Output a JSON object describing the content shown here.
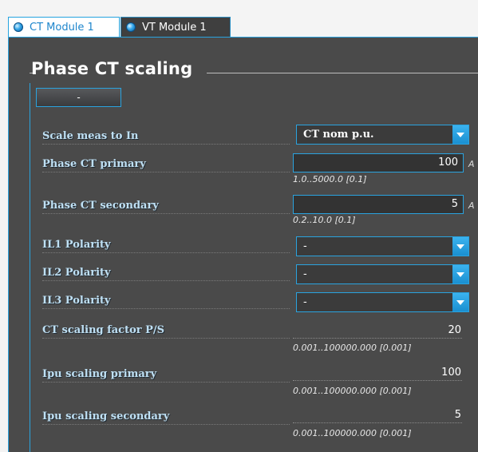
{
  "tabs": [
    {
      "label": "CT Module 1",
      "active": true
    },
    {
      "label": "VT Module 1",
      "active": false
    }
  ],
  "section": {
    "title": "Phase CT scaling",
    "collapse_label": "-"
  },
  "fields": {
    "scale_meas": {
      "label": "Scale meas to In",
      "value": "CT nom p.u."
    },
    "ct_primary": {
      "label": "Phase CT primary",
      "value": "100",
      "unit": "A",
      "range": "1.0..5000.0 [0.1]"
    },
    "ct_secondary": {
      "label": "Phase CT secondary",
      "value": "5",
      "unit": "A",
      "range": "0.2..10.0 [0.1]"
    },
    "il1_polarity": {
      "label": "IL1 Polarity",
      "value": "-"
    },
    "il2_polarity": {
      "label": "IL2 Polarity",
      "value": "-"
    },
    "il3_polarity": {
      "label": "IL3 Polarity",
      "value": "-"
    },
    "ct_scaling_factor": {
      "label": "CT scaling factor P/S",
      "value": "20",
      "range": "0.001..100000.000 [0.001]"
    },
    "ipu_primary": {
      "label": "Ipu scaling primary",
      "value": "100",
      "range": "0.001..100000.000 [0.001]"
    },
    "ipu_secondary": {
      "label": "Ipu scaling secondary",
      "value": "5",
      "range": "0.001..100000.000 [0.001]"
    }
  },
  "colors": {
    "accent": "#2aa3df",
    "panel_bg": "#4a4a4a",
    "label_text": "#bfe0f4"
  }
}
